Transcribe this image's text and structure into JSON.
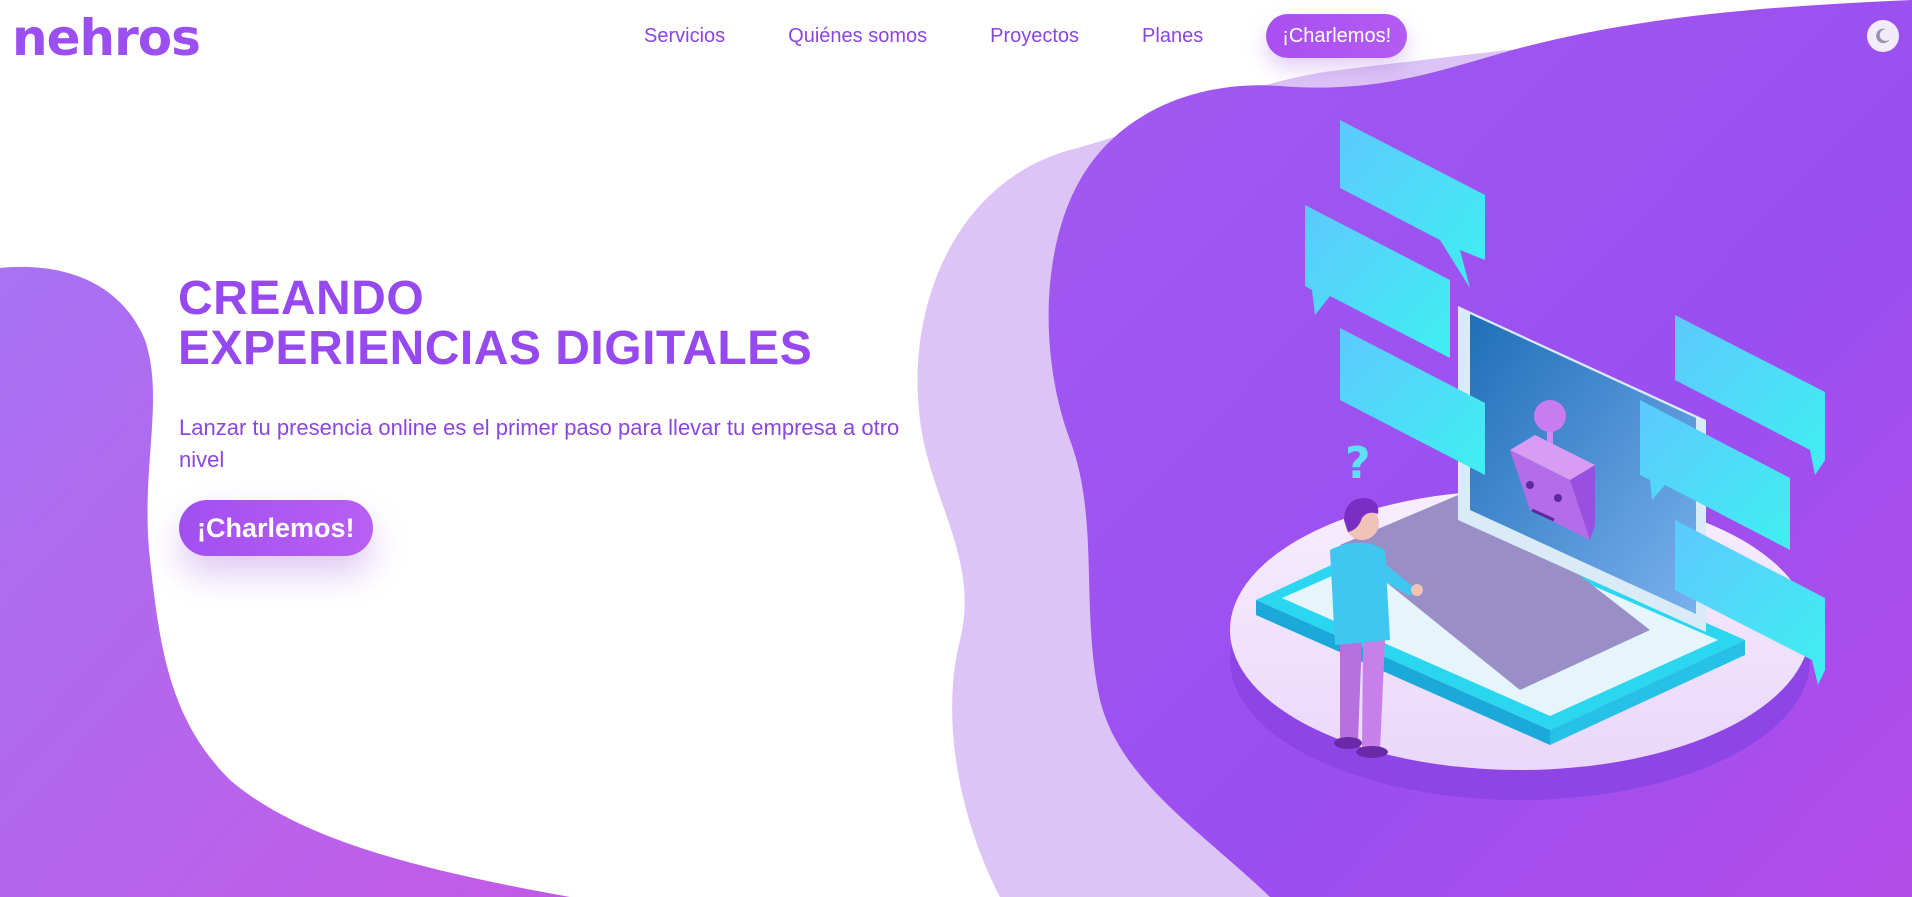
{
  "brand": {
    "logo_text": "nehros",
    "primary_color": "#9b4ff0",
    "text_color": "#8a46e0"
  },
  "nav": {
    "items": [
      {
        "label": "Servicios"
      },
      {
        "label": "Quiénes somos"
      },
      {
        "label": "Proyectos"
      },
      {
        "label": "Planes"
      }
    ],
    "cta_label": "¡Charlemos!",
    "theme_toggle_icon": "moon-icon"
  },
  "hero": {
    "title_line1": "CREANDO",
    "title_line2": "EXPERIENCIAS DIGITALES",
    "subtitle": "Lanzar tu presencia online es el primer paso para llevar tu empresa a otro nivel",
    "cta_label": "¡Charlemos!"
  },
  "illustration": {
    "name": "person-at-laptop-chatbot-illustration",
    "accent_cyan": "#3fd4f5",
    "accent_purple": "#9b4ff0"
  }
}
